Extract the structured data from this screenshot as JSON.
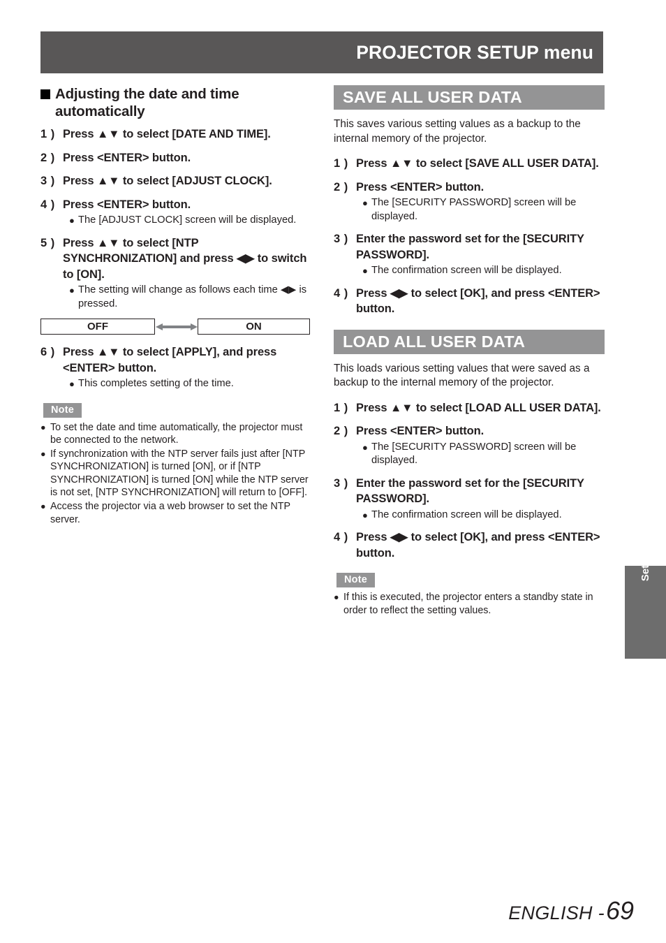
{
  "header": {
    "title": "PROJECTOR SETUP menu"
  },
  "left_column": {
    "subheading": "Adjusting the date and time automatically",
    "steps": [
      {
        "num": "1 )",
        "text": "Press ▲▼ to select [DATE AND TIME]."
      },
      {
        "num": "2 )",
        "text": "Press <ENTER> button."
      },
      {
        "num": "3 )",
        "text": "Press ▲▼ to select [ADJUST CLOCK]."
      },
      {
        "num": "4 )",
        "text": "Press <ENTER> button.",
        "bullets": [
          "The [ADJUST CLOCK] screen will be displayed."
        ]
      },
      {
        "num": "5 )",
        "text": "Press ▲▼ to select [NTP SYNCHRONIZATION] and press ◀▶ to switch to [ON].",
        "bullets": [
          "The setting will change as follows each time ◀▶ is pressed."
        ]
      },
      {
        "num": "6 )",
        "text": "Press ▲▼ to select [APPLY], and press <ENTER> button.",
        "bullets": [
          "This completes setting of the time."
        ]
      }
    ],
    "toggle_diagram": {
      "left_label": "OFF",
      "right_label": "ON",
      "arrow_icon": "double-headed-arrow-icon"
    },
    "note": {
      "label": "Note",
      "items": [
        "To set the date and time automatically, the projector must be connected to the network.",
        "If synchronization with the NTP server fails just after [NTP SYNCHRONIZATION] is turned [ON], or if [NTP SYNCHRONIZATION] is turned [ON] while the NTP server is not set, [NTP SYNCHRONIZATION] will return to [OFF].",
        "Access the projector via a web browser to set the NTP server."
      ]
    }
  },
  "right_column": {
    "save_section": {
      "title": "SAVE ALL USER DATA",
      "intro": "This saves various setting values as a backup to the internal memory of the projector.",
      "steps": [
        {
          "num": "1 )",
          "text": "Press ▲▼ to select [SAVE ALL USER DATA]."
        },
        {
          "num": "2 )",
          "text": "Press <ENTER> button.",
          "bullets": [
            "The [SECURITY PASSWORD] screen will be displayed."
          ]
        },
        {
          "num": "3 )",
          "text": "Enter the password set for the [SECURITY PASSWORD].",
          "bullets": [
            "The confirmation screen will be displayed."
          ]
        },
        {
          "num": "4 )",
          "text": "Press ◀▶ to select [OK], and press <ENTER> button."
        }
      ]
    },
    "load_section": {
      "title": "LOAD ALL USER DATA",
      "intro": "This loads various setting values that were saved as a backup to the internal memory of the projector.",
      "steps": [
        {
          "num": "1 )",
          "text": "Press ▲▼ to select [LOAD ALL USER DATA]."
        },
        {
          "num": "2 )",
          "text": "Press <ENTER> button.",
          "bullets": [
            "The [SECURITY PASSWORD] screen will be displayed."
          ]
        },
        {
          "num": "3 )",
          "text": "Enter the password set for the [SECURITY PASSWORD].",
          "bullets": [
            "The confirmation screen will be displayed."
          ]
        },
        {
          "num": "4 )",
          "text": "Press ◀▶ to select [OK], and press <ENTER> button."
        }
      ],
      "note": {
        "label": "Note",
        "items": [
          "If this is executed, the projector enters a standby state in order to reflect the setting values."
        ]
      }
    }
  },
  "side_tab": {
    "label": "Settings"
  },
  "footer": {
    "language": "ENGLISH -",
    "page_number": "69"
  },
  "colors": {
    "header_bar": "#595757",
    "section_bar": "#949495",
    "side_tab": "#6d6d6d",
    "note_badge": "#949495",
    "text": "#231f20",
    "arrow": "#808285"
  }
}
